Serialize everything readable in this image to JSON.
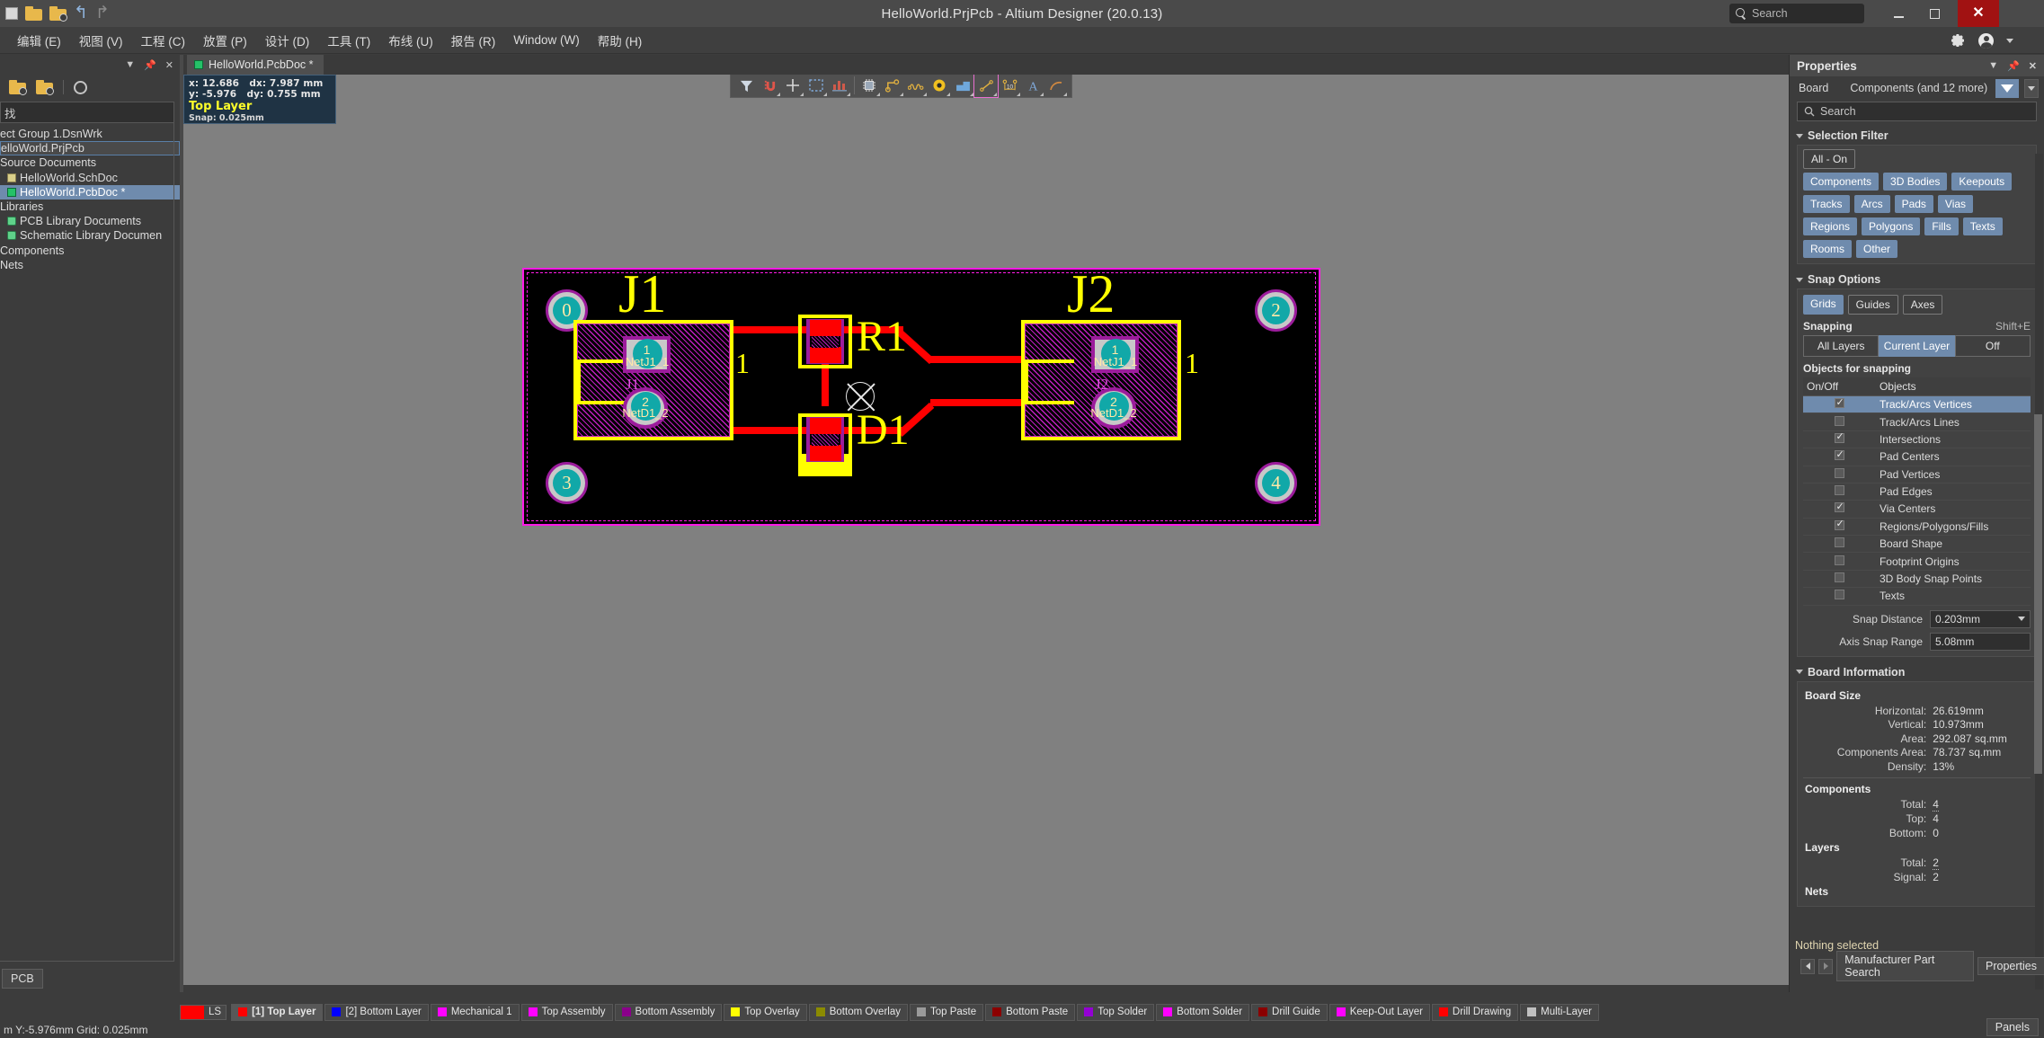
{
  "window": {
    "title": "HelloWorld.PrjPcb - Altium Designer (20.0.13)",
    "search_placeholder": "Search",
    "minimize": "_",
    "maximize": "□",
    "close": "✕"
  },
  "menu": {
    "items": [
      "编辑 (E)",
      "视图 (V)",
      "工程 (C)",
      "放置 (P)",
      "设计 (D)",
      "工具 (T)",
      "布线 (U)",
      "报告 (R)",
      "Window (W)",
      "帮助 (H)"
    ]
  },
  "left_panel": {
    "search_placeholder": "找",
    "tree": [
      {
        "label": "ect Group 1.DsnWrk",
        "icon": "none",
        "state": "normal"
      },
      {
        "label": "elloWorld.PrjPcb",
        "icon": "none",
        "state": "outlined"
      },
      {
        "label": "Source Documents",
        "icon": "none",
        "state": "normal"
      },
      {
        "label": "HelloWorld.SchDoc",
        "icon": "sch",
        "state": "normal"
      },
      {
        "label": "HelloWorld.PcbDoc *",
        "icon": "pcb",
        "state": "selected"
      },
      {
        "label": "Libraries",
        "icon": "none",
        "state": "normal"
      },
      {
        "label": "PCB Library Documents",
        "icon": "lib",
        "state": "normal"
      },
      {
        "label": "Schematic Library Documen",
        "icon": "lib",
        "state": "normal"
      },
      {
        "label": "Components",
        "icon": "none",
        "state": "normal"
      },
      {
        "label": "Nets",
        "icon": "none",
        "state": "normal"
      }
    ],
    "bottom_tab": "PCB"
  },
  "document_tab": {
    "label": "HelloWorld.PcbDoc *"
  },
  "hud": {
    "x_label": "x:",
    "x_value": "12.686",
    "dx_label": "dx:",
    "dx_value": "7.987",
    "unit1": "mm",
    "y_label": "y:",
    "y_value": "-5.976",
    "dy_label": "dy:",
    "dy_value": "0.755",
    "unit2": "mm",
    "layer": "Top Layer",
    "snap": "Snap: 0.025mm"
  },
  "canvas_toolbar": {
    "icons": [
      "filter-icon",
      "magnet-icon",
      "crosshair-icon",
      "selection-rect-icon",
      "chart-icon",
      "component-icon",
      "route-track-icon",
      "interactive-length-tuning-icon",
      "via-icon",
      "fill-icon",
      "line-dimension-icon",
      "dimension-10-icon",
      "text-icon",
      "arc-icon"
    ]
  },
  "pcb": {
    "mounting_holes": [
      "0",
      "2",
      "3",
      "4"
    ],
    "components": [
      {
        "refdes": "J1",
        "inner_label": "J1",
        "pads": [
          {
            "num": "1",
            "net": "NetJ1_1"
          },
          {
            "num": "2",
            "net": "NetD1_2"
          }
        ]
      },
      {
        "refdes": "J2",
        "inner_label": "J2",
        "pads": [
          {
            "num": "1",
            "net": "NetJ1_1"
          },
          {
            "num": "2",
            "net": "NetD1_2"
          }
        ]
      },
      {
        "refdes": "R1",
        "inner_label": "R1",
        "pads": []
      },
      {
        "refdes": "D1",
        "inner_label": "D1",
        "pads": []
      }
    ],
    "pin_numbers": [
      "1",
      "1"
    ]
  },
  "properties": {
    "title": "Properties",
    "object_kind_label": "Board",
    "object_kind_value": "Components (and 12 more)",
    "search_placeholder": "Search",
    "selection_filter": {
      "heading": "Selection Filter",
      "all_on": "All - On",
      "chips": [
        {
          "label": "Components",
          "on": true
        },
        {
          "label": "3D Bodies",
          "on": true
        },
        {
          "label": "Keepouts",
          "on": true
        },
        {
          "label": "Tracks",
          "on": true
        },
        {
          "label": "Arcs",
          "on": true
        },
        {
          "label": "Pads",
          "on": true
        },
        {
          "label": "Vias",
          "on": true
        },
        {
          "label": "Regions",
          "on": true
        },
        {
          "label": "Polygons",
          "on": true
        },
        {
          "label": "Fills",
          "on": true
        },
        {
          "label": "Texts",
          "on": true
        },
        {
          "label": "Rooms",
          "on": true
        },
        {
          "label": "Other",
          "on": true
        }
      ]
    },
    "snap_options": {
      "heading": "Snap Options",
      "modes": [
        {
          "label": "Grids",
          "on": true
        },
        {
          "label": "Guides",
          "on": false
        },
        {
          "label": "Axes",
          "on": false
        }
      ],
      "snapping_label": "Snapping",
      "snapping_shortcut": "Shift+E",
      "snapping_segments": [
        {
          "label": "All Layers",
          "on": false
        },
        {
          "label": "Current Layer",
          "on": true
        },
        {
          "label": "Off",
          "on": false
        }
      ],
      "objects_label": "Objects for snapping",
      "table_headers": [
        "On/Off",
        "Objects"
      ],
      "objects": [
        {
          "name": "Track/Arcs Vertices",
          "checked": true,
          "selected": true
        },
        {
          "name": "Track/Arcs Lines",
          "checked": false,
          "selected": false
        },
        {
          "name": "Intersections",
          "checked": true,
          "selected": false
        },
        {
          "name": "Pad Centers",
          "checked": true,
          "selected": false
        },
        {
          "name": "Pad Vertices",
          "checked": false,
          "selected": false
        },
        {
          "name": "Pad Edges",
          "checked": false,
          "selected": false
        },
        {
          "name": "Via Centers",
          "checked": true,
          "selected": false
        },
        {
          "name": "Regions/Polygons/Fills",
          "checked": true,
          "selected": false
        },
        {
          "name": "Board Shape",
          "checked": false,
          "selected": false
        },
        {
          "name": "Footprint Origins",
          "checked": false,
          "selected": false
        },
        {
          "name": "3D Body Snap Points",
          "checked": false,
          "selected": false
        },
        {
          "name": "Texts",
          "checked": false,
          "selected": false
        }
      ],
      "snap_distance_label": "Snap Distance",
      "snap_distance_value": "0.203mm",
      "axis_snap_label": "Axis Snap Range",
      "axis_snap_value": "5.08mm"
    },
    "board_information": {
      "heading": "Board Information",
      "board_size_label": "Board Size",
      "rows": [
        {
          "key": "Horizontal:",
          "value": "26.619mm"
        },
        {
          "key": "Vertical:",
          "value": "10.973mm"
        },
        {
          "key": "Area:",
          "value": "292.087 sq.mm"
        },
        {
          "key": "Components Area:",
          "value": "78.737 sq.mm"
        },
        {
          "key": "Density:",
          "value": "13%"
        }
      ],
      "components_label": "Components",
      "components_rows": [
        {
          "key": "Total:",
          "value": "4",
          "link": true
        },
        {
          "key": "Top:",
          "value": "4",
          "link": false
        },
        {
          "key": "Bottom:",
          "value": "0",
          "link": false
        }
      ],
      "layers_label": "Layers",
      "layers_rows": [
        {
          "key": "Total:",
          "value": "2",
          "link": true
        },
        {
          "key": "Signal:",
          "value": "2",
          "link": false
        }
      ],
      "nets_label": "Nets"
    },
    "status": "Nothing selected",
    "tabs": [
      "Manufacturer Part Search",
      "Properties"
    ]
  },
  "layer_bar": {
    "ls_button": "LS",
    "ls_color": "#ff0000",
    "layers": [
      {
        "label": "[1] Top Layer",
        "color": "#ff0000",
        "active": true
      },
      {
        "label": "[2] Bottom Layer",
        "color": "#0000ff",
        "active": false
      },
      {
        "label": "Mechanical 1",
        "color": "#ff00ff",
        "active": false
      },
      {
        "label": "Top Assembly",
        "color": "#ff00ff",
        "active": false
      },
      {
        "label": "Bottom Assembly",
        "color": "#8b008b",
        "active": false
      },
      {
        "label": "Top Overlay",
        "color": "#ffff00",
        "active": false
      },
      {
        "label": "Bottom Overlay",
        "color": "#8b8b00",
        "active": false
      },
      {
        "label": "Top Paste",
        "color": "#9a9a9a",
        "active": false
      },
      {
        "label": "Bottom Paste",
        "color": "#8b0000",
        "active": false
      },
      {
        "label": "Top Solder",
        "color": "#9400d3",
        "active": false
      },
      {
        "label": "Bottom Solder",
        "color": "#ff00ff",
        "active": false
      },
      {
        "label": "Drill Guide",
        "color": "#8b0000",
        "active": false
      },
      {
        "label": "Keep-Out Layer",
        "color": "#ff00ff",
        "active": false
      },
      {
        "label": "Drill Drawing",
        "color": "#ff0000",
        "active": false
      },
      {
        "label": "Multi-Layer",
        "color": "#c0c0c0",
        "active": false
      }
    ]
  },
  "status_bar": {
    "left": "m Y:-5.976mm     Grid: 0.025mm",
    "panels_button": "Panels"
  }
}
